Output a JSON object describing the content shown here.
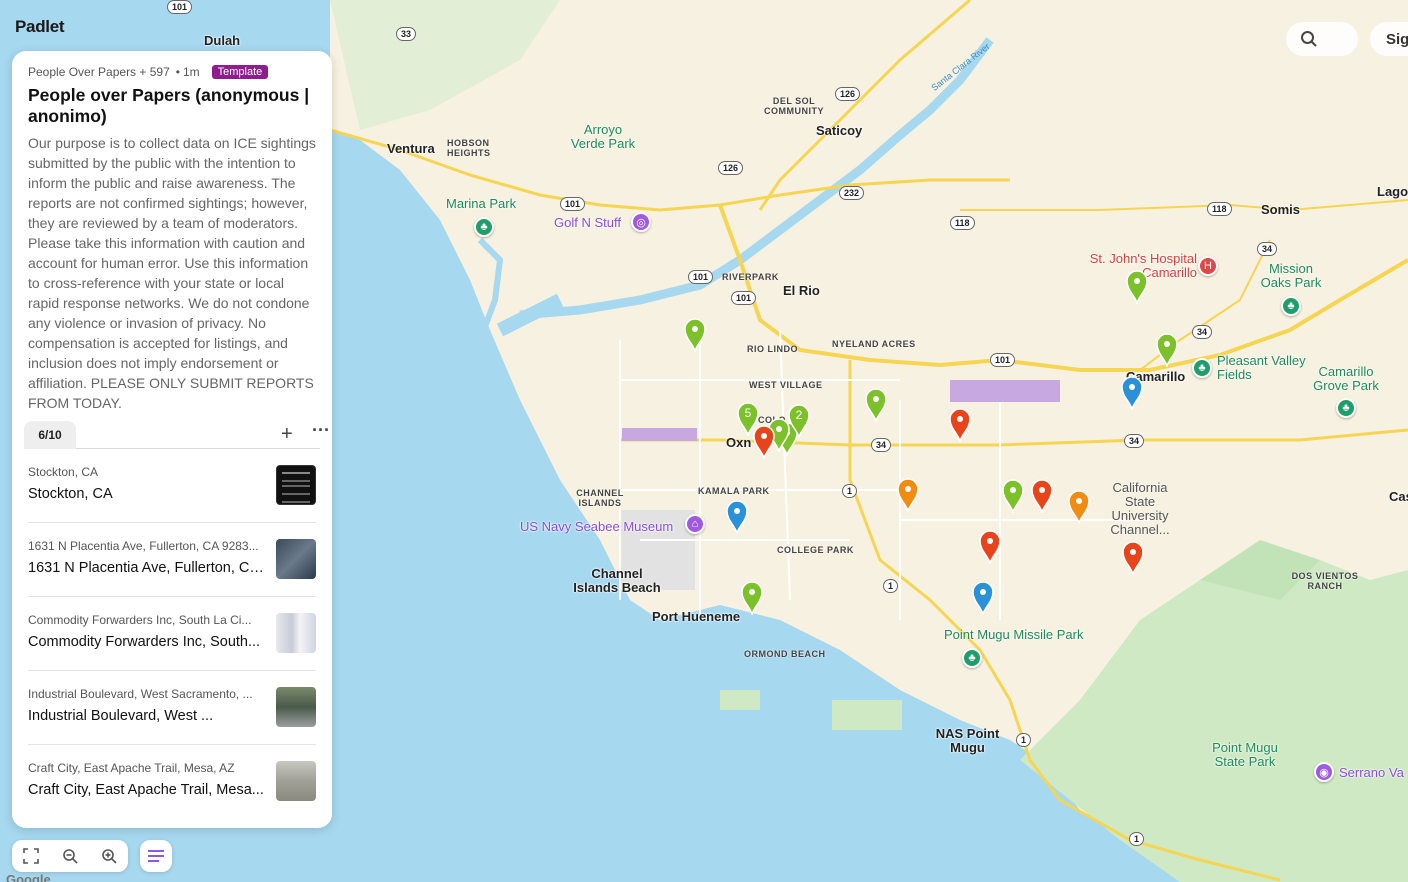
{
  "app": {
    "logo": "Padlet"
  },
  "header": {
    "signin_label": "Sig"
  },
  "panel": {
    "author": "People Over Papers + 597",
    "dot": "•",
    "time": "1m",
    "badge": "Template",
    "title": "People over Papers (anonymous | anonimo)",
    "description": "Our purpose is to collect data on ICE sightings submitted by the public with the intention to inform the public and raise awareness. The reports are not confirmed sightings; however, they are reviewed by a team of moderators. Please take this information with caution and account for human error. Use this information to cross-reference with your state or local rapid response networks. We do not condone any violence or invasion of privacy. No compensation is accepted for listings, and inclusion does not imply endorsement or affiliation. PLEASE ONLY SUBMIT REPORTS FROM TODAY.",
    "tab_count": "6/10",
    "add_label": "+",
    "more_label": "···",
    "items": [
      {
        "sub": "Stockton, CA",
        "main": "Stockton, CA"
      },
      {
        "sub": "1631 N Placentia Ave, Fullerton, CA 9283...",
        "main": "1631 N Placentia Ave, Fullerton, CA..."
      },
      {
        "sub": "Commodity Forwarders Inc, South La Ci...",
        "main": "Commodity Forwarders Inc, South..."
      },
      {
        "sub": "Industrial Boulevard, West Sacramento, ...",
        "main": "Industrial Boulevard, West ..."
      },
      {
        "sub": "Craft City, East Apache Trail, Mesa, AZ",
        "main": "Craft City, East Apache Trail, Mesa..."
      }
    ]
  },
  "map": {
    "attribution": "Google",
    "cities": [
      "Dulah",
      "Ventura",
      "Saticoy",
      "El Rio",
      "Oxn",
      "Camarillo",
      "Somis",
      "Port Hueneme",
      "Channel Islands Beach",
      "NAS Point Mugu",
      "Lago",
      "Cas"
    ],
    "hoods": [
      "HOBSON HEIGHTS",
      "DEL SOL COMMUNITY",
      "RIVERPARK",
      "RIO LINDO",
      "NYELAND ACRES",
      "WEST VILLAGE",
      "COLO",
      "CHANNEL ISLANDS",
      "KAMALA PARK",
      "COLLEGE PARK",
      "ORMOND BEACH",
      "DOS VIENTOS RANCH"
    ],
    "parks": [
      "Arroyo Verde Park",
      "Marina Park",
      "Mission Oaks Park",
      "Pleasant Valley Fields",
      "Camarillo Grove Park",
      "Point Mugu Missile Park",
      "Point Mugu State Park",
      "California State University Channel..."
    ],
    "pois": [
      "Golf N Stuff",
      "US Navy Seabee Museum",
      "Serrano Va"
    ],
    "hospital": "St. John's Hospital Camarillo",
    "river": "Santa Clara River",
    "shields": [
      "101",
      "33",
      "126",
      "126",
      "232",
      "118",
      "118",
      "101",
      "101",
      "101",
      "34",
      "34",
      "34",
      "34",
      "1",
      "1",
      "1",
      "1",
      "101"
    ],
    "cluster_counts": [
      "5",
      "2"
    ]
  },
  "colors": {
    "green_pin": "#7cc02a",
    "red_pin": "#e8441c",
    "orange_pin": "#f08c12",
    "blue_pin": "#2a90d8",
    "badge": "#8e1d8e",
    "water": "#a6d8f0",
    "land": "#f7f1e1",
    "hills": "#cfe9c5"
  }
}
